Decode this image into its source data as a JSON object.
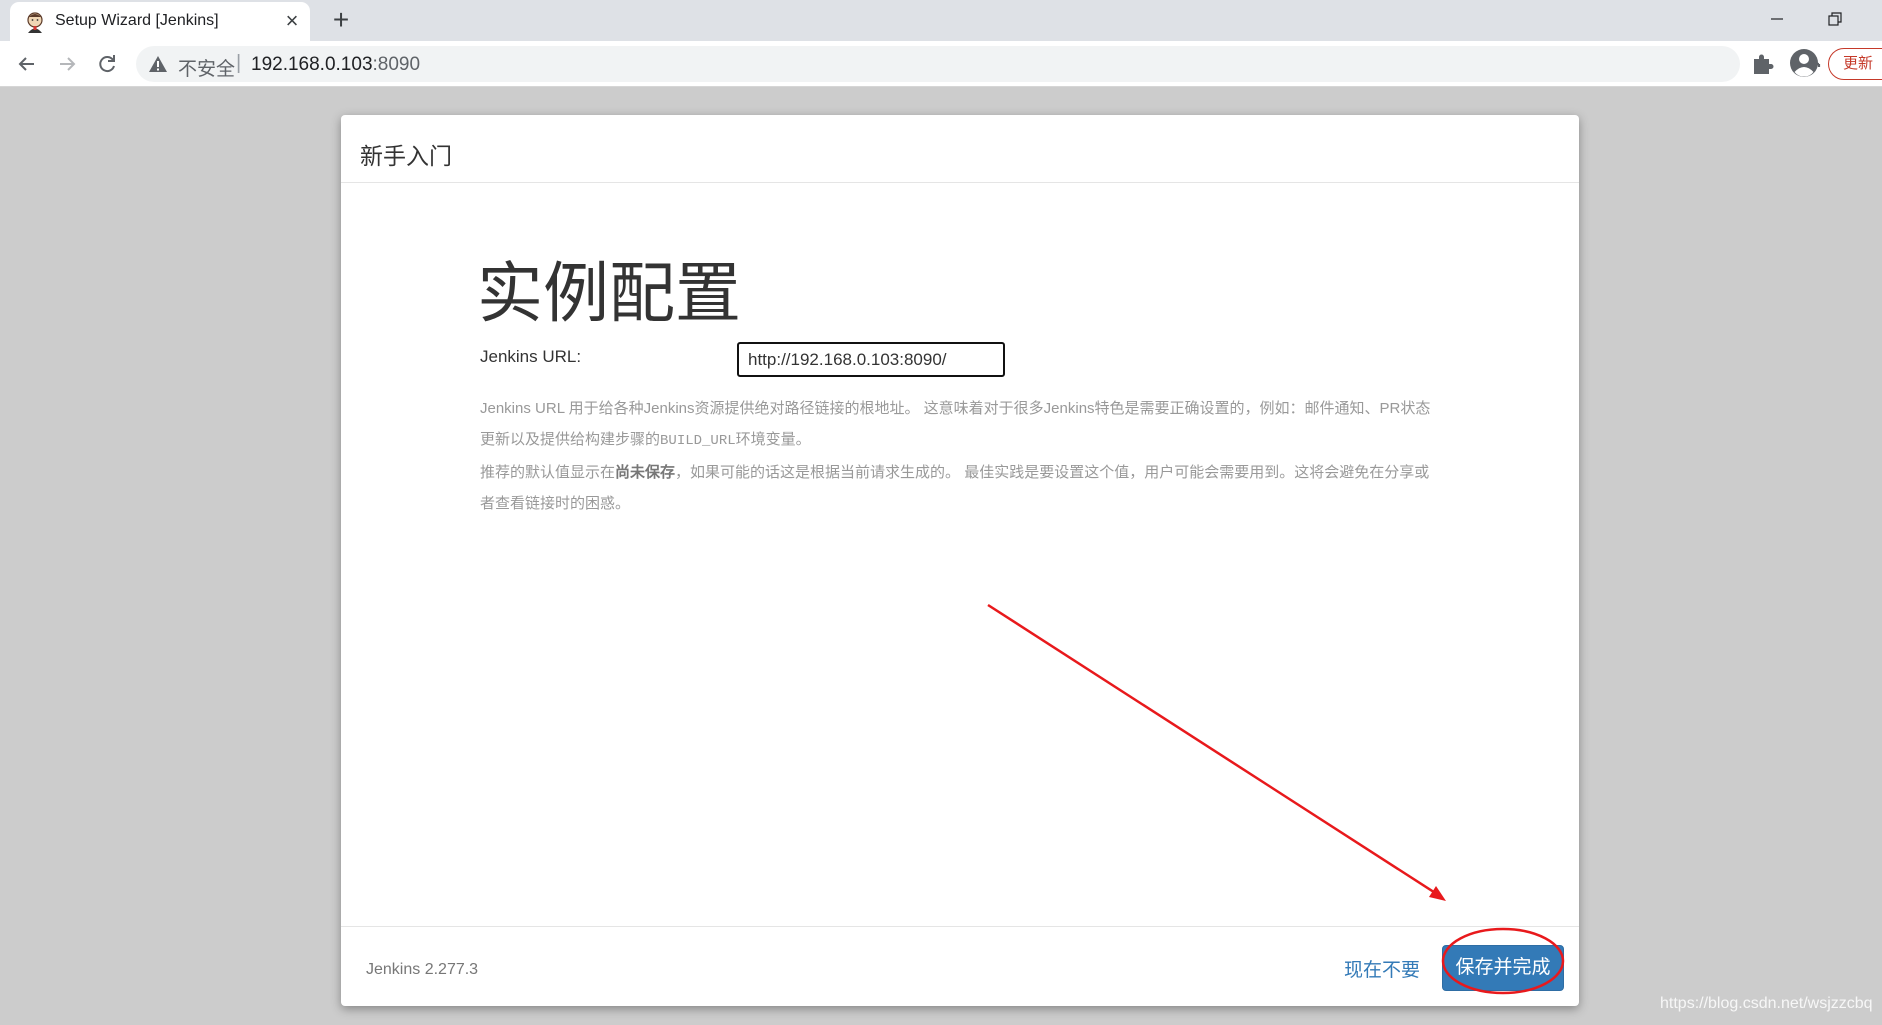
{
  "browser": {
    "tab_title": "Setup Wizard [Jenkins]",
    "tab_close": "×",
    "new_tab": "+",
    "insecure_label": "不安全",
    "url_separator": "|",
    "url_host": "192.168.0.103",
    "url_port": ":8090",
    "update_label": "更新"
  },
  "dialog": {
    "header_title": "新手入门",
    "page_title": "实例配置",
    "url_label": "Jenkins URL:",
    "url_value": "http://192.168.0.103:8090/",
    "help": {
      "p1_text": "Jenkins URL 用于给各种Jenkins资源提供绝对路径链接的根地址。 这意味着对于很多Jenkins特色是需要正确设置的，例如：邮件通知、PR状态更新以及提供给构建步骤的",
      "p1_code": "BUILD_URL",
      "p1_tail": "环境变量。",
      "p2_text": "推荐的默认值显示在",
      "p2_bold": "尚未保存",
      "p2_tail": "，如果可能的话这是根据当前请求生成的。 最佳实践是要设置这个值，用户可能会需要用到。这将会避免在分享或者查看链接时的困惑。"
    },
    "footer": {
      "version": "Jenkins 2.277.3",
      "skip_label": "现在不要",
      "save_label": "保存并完成"
    }
  },
  "watermark": "https://blog.csdn.net/wsjzzcbq",
  "colors": {
    "primary": "#337ab7",
    "annotation": "#e8191c",
    "update": "#c53929"
  }
}
